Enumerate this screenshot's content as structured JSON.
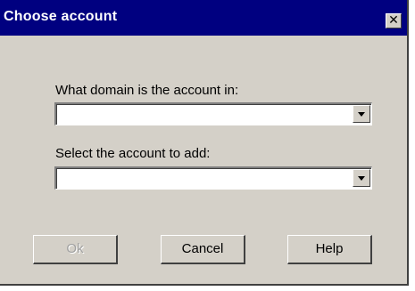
{
  "window": {
    "title": "Choose account",
    "close_glyph": "✕"
  },
  "form": {
    "domain_label": "What domain is the account in:",
    "domain_value": "",
    "account_label": "Select the account to add:",
    "account_value": ""
  },
  "buttons": {
    "ok_label": "Ok",
    "cancel_label": "Cancel",
    "help_label": "Help"
  }
}
